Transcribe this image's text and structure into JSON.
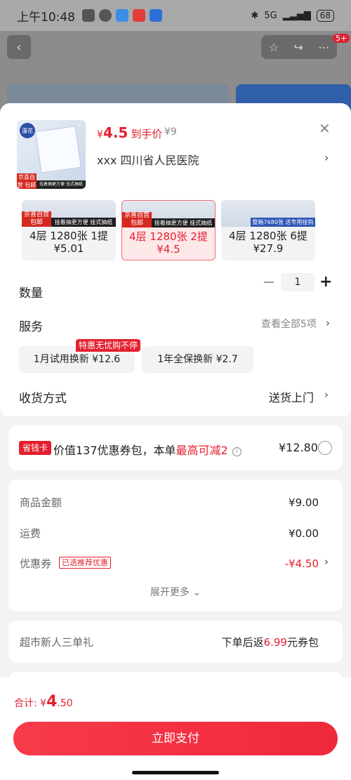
{
  "status_bar": {
    "time": "上午10:48",
    "network": "5G",
    "battery": "68"
  },
  "product": {
    "brand": "漫花",
    "thumb_tag": "京喜自营 包邮",
    "thumb_strip": "挂着抽更方便 挂式抽纸",
    "price_symbol": "¥",
    "price": "4.5",
    "price_label": "到手价",
    "original_price": "¥9",
    "address": "xxx 四川省人民医院"
  },
  "variants": [
    {
      "tag": "京喜自营 包邮",
      "strip": "挂着抽更方便 挂式抽纸",
      "name": "4层 1280张 1提",
      "price": "¥5.01",
      "selected": false
    },
    {
      "tag": "京喜自营 包邮",
      "strip": "挂着抽更方便 挂式抽纸",
      "name": "4层 1280张 2提",
      "price": "¥4.5",
      "selected": true
    },
    {
      "tag": "",
      "strip": "整箱7680张 送专用挂钩",
      "name": "4层 1280张 6提",
      "price": "¥27.9",
      "selected": false
    }
  ],
  "quantity": {
    "label": "数量",
    "value": "1"
  },
  "service": {
    "label": "服务",
    "view_all": "查看全部5项",
    "promo_tag": "特惠无忧购不停",
    "options": [
      {
        "text": "1月试用换新 ¥12.6"
      },
      {
        "text": "1年全保换新 ¥2.7"
      }
    ]
  },
  "delivery": {
    "label": "收货方式",
    "value": "送货上门"
  },
  "savings": {
    "badge": "省钱卡",
    "text": "价值137优惠券包，本单",
    "highlight": "最高可减2",
    "info": "i",
    "price": "¥12.80"
  },
  "costs": {
    "items": [
      {
        "label": "商品金额",
        "value": "¥9.00"
      },
      {
        "label": "运费",
        "value": "¥0.00"
      },
      {
        "label": "优惠券",
        "value": "-¥4.50"
      }
    ],
    "coupon_tag": "已选推荐优惠",
    "expand": "展开更多"
  },
  "new_user": {
    "label": "超市新人三单礼",
    "prefix": "下单后返",
    "amount": "6.99",
    "suffix": "元券包"
  },
  "footer": {
    "total_label": "合计:",
    "total_symbol": "¥",
    "total_int": "4",
    "total_dec": ".50",
    "pay_button": "立即支付"
  }
}
